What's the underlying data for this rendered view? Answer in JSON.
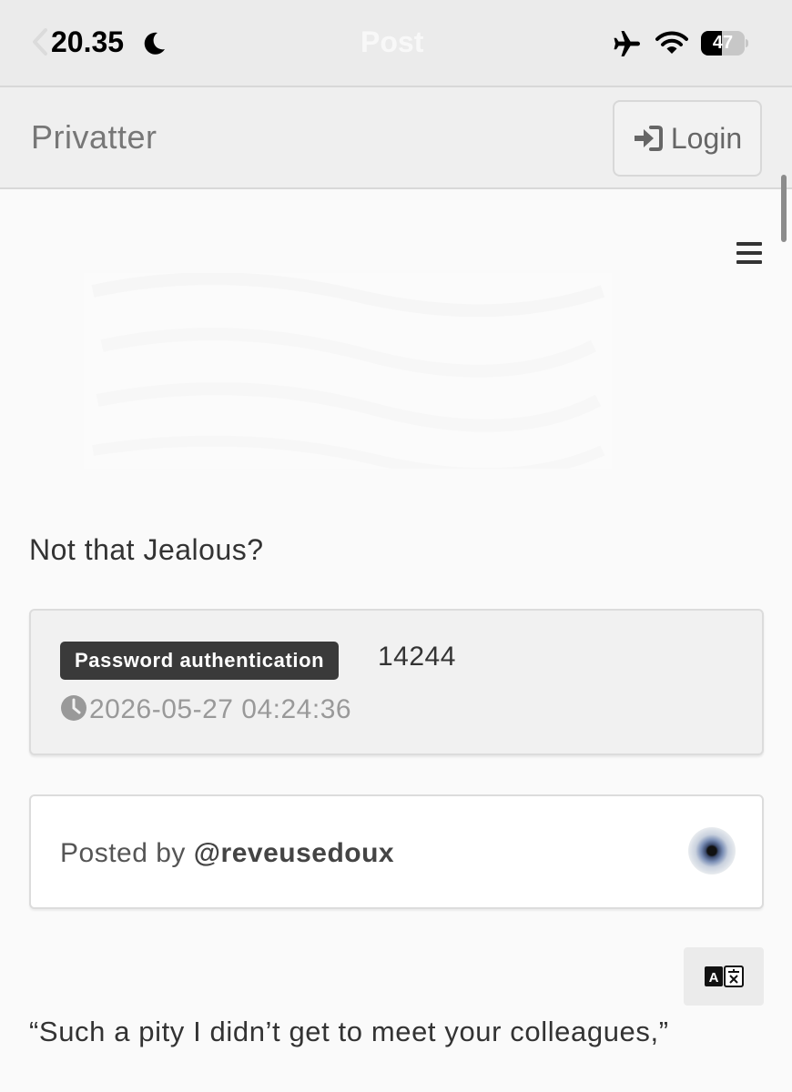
{
  "status_bar": {
    "time": "20.35",
    "ghost_title": "Post",
    "battery_level": "47",
    "battery_fraction": 0.47,
    "icons": [
      "moon-icon",
      "airplane-icon",
      "wifi-icon",
      "battery-icon"
    ]
  },
  "navbar": {
    "brand": "Privatter",
    "login_label": "Login",
    "login_icon": "sign-in-icon"
  },
  "menu": {
    "icon": "hamburger-menu-icon"
  },
  "post": {
    "title": "Not that Jealous?",
    "auth_badge": "Password authentication",
    "auth_count": "14244",
    "timestamp": "2026-05-27 04:24:36",
    "posted_by_prefix": "Posted by ",
    "author_handle": "@reveusedoux",
    "translate_icon": "translate-icon",
    "body_first_line": "“Such a pity I didn’t get to meet your colleagues,”"
  },
  "colors": {
    "status_bar_bg": "#ebebeb",
    "navbar_bg": "#efefef",
    "page_bg": "#fafafa",
    "badge_bg": "#3a3a3a",
    "muted_text": "#999999"
  }
}
